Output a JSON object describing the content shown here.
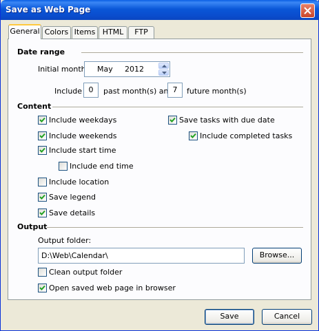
{
  "window": {
    "title": "Save as Web Page"
  },
  "tabs": [
    {
      "label": "General",
      "active": true
    },
    {
      "label": "Colors"
    },
    {
      "label": "Items"
    },
    {
      "label": "HTML"
    },
    {
      "label": "FTP"
    }
  ],
  "date_range": {
    "title": "Date range",
    "initial_month_label": "Initial month:",
    "month": "May",
    "year": "2012",
    "include_label": "Include",
    "past_months": "0",
    "past_label": "past month(s) and",
    "future_months": "7",
    "future_label": "future month(s)"
  },
  "content": {
    "title": "Content",
    "include_weekdays": {
      "label": "Include weekdays",
      "checked": true
    },
    "include_weekends": {
      "label": "Include weekends",
      "checked": true
    },
    "include_start_time": {
      "label": "Include start time",
      "checked": true
    },
    "include_end_time": {
      "label": "Include end time",
      "checked": false
    },
    "include_location": {
      "label": "Include location",
      "checked": false
    },
    "save_legend": {
      "label": "Save legend",
      "checked": true
    },
    "save_details": {
      "label": "Save details",
      "checked": true
    },
    "save_tasks_due": {
      "label": "Save tasks with due date",
      "checked": true
    },
    "include_completed": {
      "label": "Include completed tasks",
      "checked": true
    }
  },
  "output": {
    "title": "Output",
    "folder_label": "Output folder:",
    "folder_value": "D:\\Web\\Calendar\\",
    "browse_label": "Browse...",
    "clean_folder": {
      "label": "Clean output folder",
      "checked": false
    },
    "open_browser": {
      "label": "Open saved web page in browser",
      "checked": true
    }
  },
  "footer": {
    "save_label": "Save",
    "cancel_label": "Cancel"
  },
  "colors": {
    "titlebar": "#0a57d8",
    "face": "#ece9d8",
    "check": "#21a121"
  }
}
